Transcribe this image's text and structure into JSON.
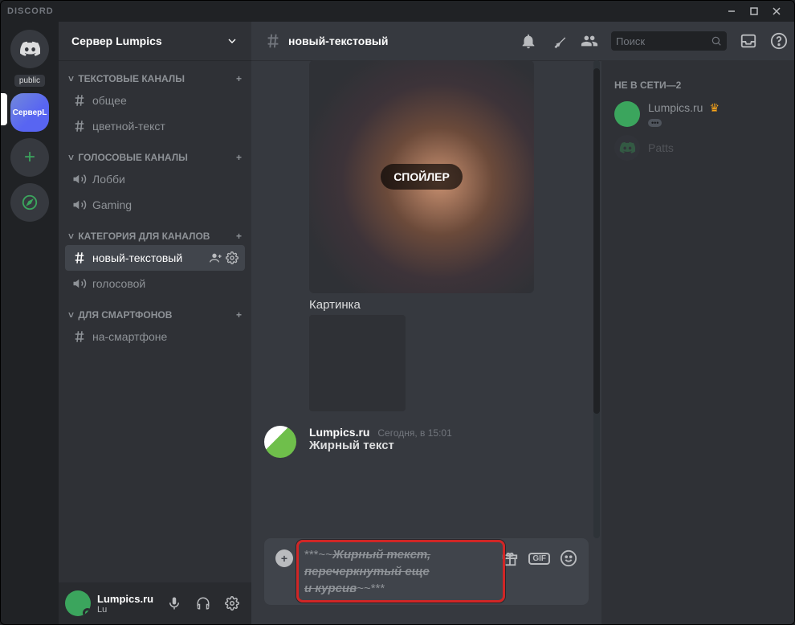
{
  "titlebar": {
    "app": "DISCORD"
  },
  "server": {
    "name": "Сервер Lumpics"
  },
  "categories": [
    {
      "name": "ТЕКСТОВЫЕ КАНАЛЫ",
      "channels": [
        {
          "type": "text",
          "label": "общее"
        },
        {
          "type": "text",
          "label": "цветной-текст"
        }
      ]
    },
    {
      "name": "ГОЛОСОВЫЕ КАНАЛЫ",
      "channels": [
        {
          "type": "voice",
          "label": "Лобби"
        },
        {
          "type": "voice",
          "label": "Gaming"
        }
      ]
    },
    {
      "name": "КАТЕГОРИЯ ДЛЯ КАНАЛОВ",
      "channels": [
        {
          "type": "text",
          "label": "новый-текстовый",
          "selected": true
        },
        {
          "type": "voice",
          "label": "голосовой"
        }
      ]
    },
    {
      "name": "ДЛЯ СМАРТФОНОВ",
      "channels": [
        {
          "type": "text",
          "label": "на-смартфоне"
        }
      ]
    }
  ],
  "guild_badge": "public",
  "selected_guild": "СерверL",
  "user": {
    "name": "Lumpics.ru",
    "status": "Lu"
  },
  "header": {
    "channel": "новый-текстовый",
    "search_placeholder": "Поиск"
  },
  "spoiler_label": "СПОЙЛЕР",
  "caption": "Картинка",
  "message": {
    "author": "Lumpics.ru",
    "timestamp": "Сегодня, в 15:01",
    "text": "Жирный текст"
  },
  "input": {
    "prefix": "***~~",
    "line1": "Жирный текст,",
    "line2": "перечеркнутый еще",
    "line3": "и курсив",
    "suffix": "~~***",
    "gif": "GIF"
  },
  "members": {
    "heading": "НЕ В СЕТИ—2",
    "list": [
      {
        "name": "Lumpics.ru",
        "owner": true,
        "status_dots": "•••"
      },
      {
        "name": "Patts",
        "offline": true
      }
    ]
  }
}
